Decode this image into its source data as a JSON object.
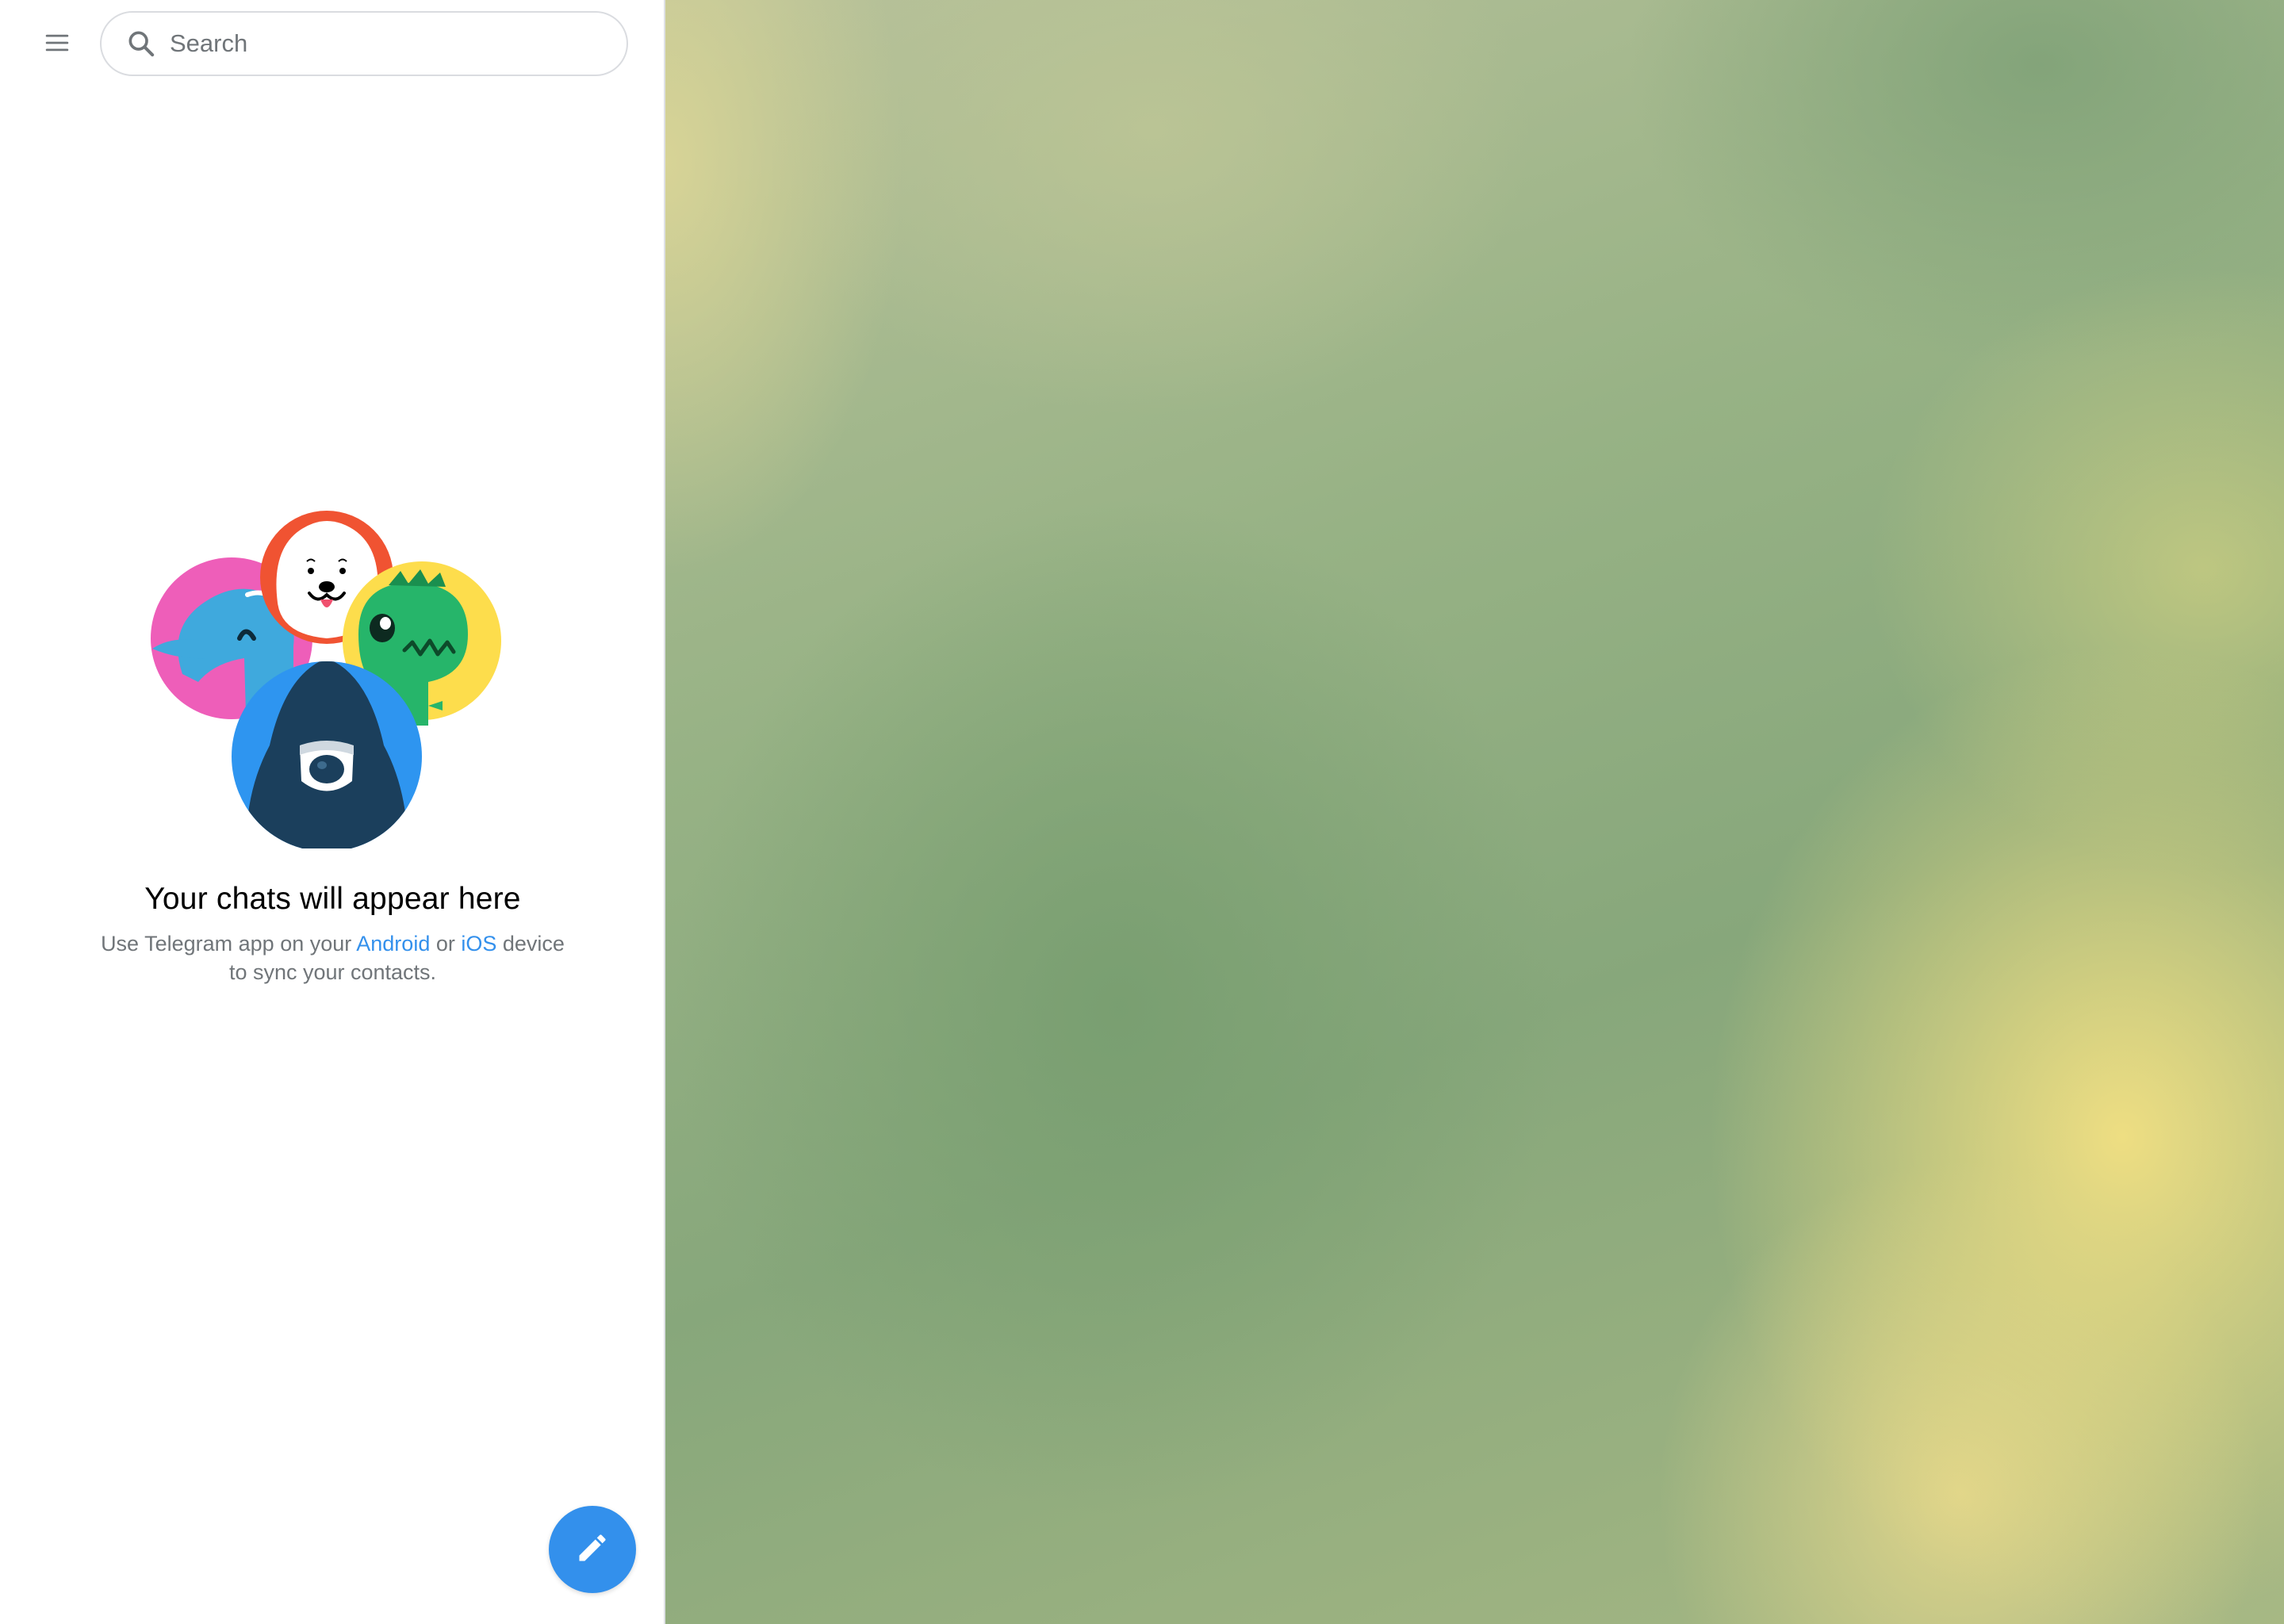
{
  "app": {
    "name": "Telegram"
  },
  "sidebar": {
    "menu_icon": "hamburger-menu-icon",
    "search": {
      "placeholder": "Search",
      "value": "",
      "icon": "search-icon"
    }
  },
  "empty_state": {
    "title": "Your chats will appear here",
    "desc_prefix": "Use Telegram app on your ",
    "android_link": "Android",
    "desc_middle": " or ",
    "ios_link": "iOS",
    "desc_suffix": " device",
    "desc_line2": "to sync your contacts."
  },
  "fab": {
    "icon": "pencil-icon"
  },
  "colors": {
    "accent": "#3390ec",
    "secondary_text": "#707579",
    "title_text": "#000000",
    "border": "#dadce0"
  }
}
